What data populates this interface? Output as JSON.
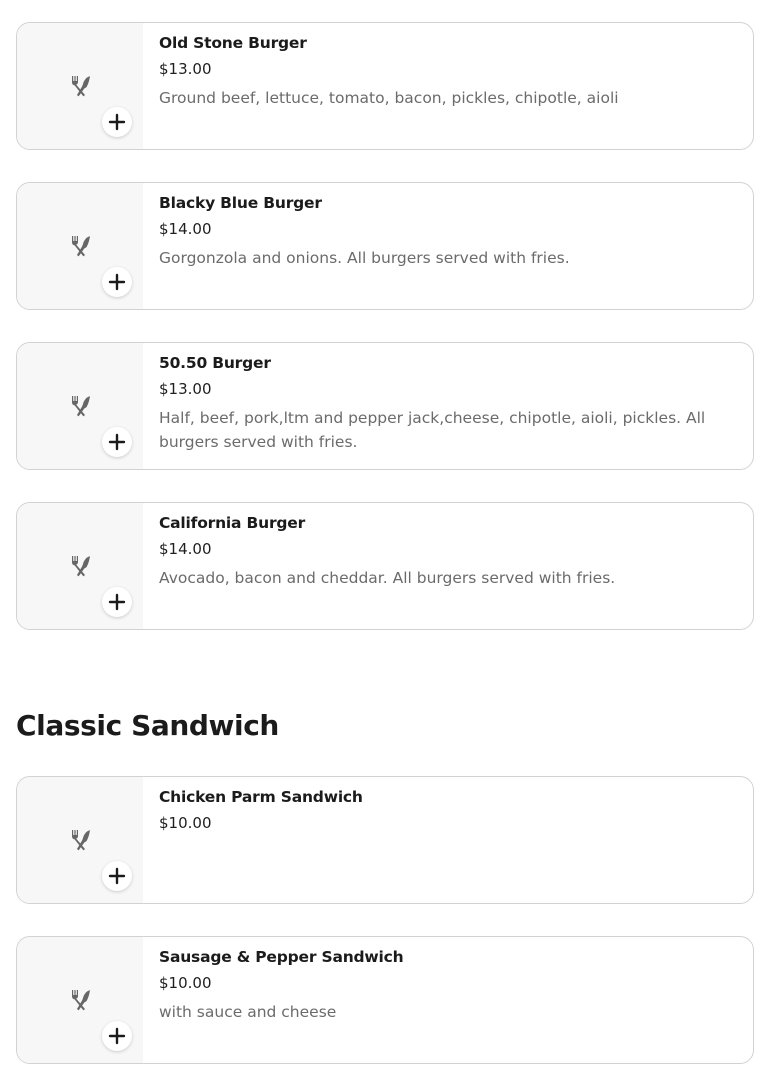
{
  "icon_names": {
    "thumbnail": "utensils-icon",
    "add": "plus-icon"
  },
  "burgers": [
    {
      "name": "Old Stone Burger",
      "price": "$13.00",
      "description": "Ground beef, lettuce, tomato, bacon, pickles, chipotle, aioli"
    },
    {
      "name": "Blacky Blue Burger",
      "price": "$14.00",
      "description": "Gorgonzola and onions. All burgers served with fries."
    },
    {
      "name": "50.50 Burger",
      "price": "$13.00",
      "description": "Half, beef, pork,ltm and pepper jack,cheese, chipotle, aioli, pickles. All burgers served with fries."
    },
    {
      "name": "California Burger",
      "price": "$14.00",
      "description": "Avocado, bacon and cheddar. All burgers served with fries."
    }
  ],
  "classic_sandwich": {
    "title": "Classic Sandwich",
    "items": [
      {
        "name": "Chicken Parm Sandwich",
        "price": "$10.00",
        "description": ""
      },
      {
        "name": "Sausage & Pepper Sandwich",
        "price": "$10.00",
        "description": "with sauce and cheese"
      }
    ]
  }
}
